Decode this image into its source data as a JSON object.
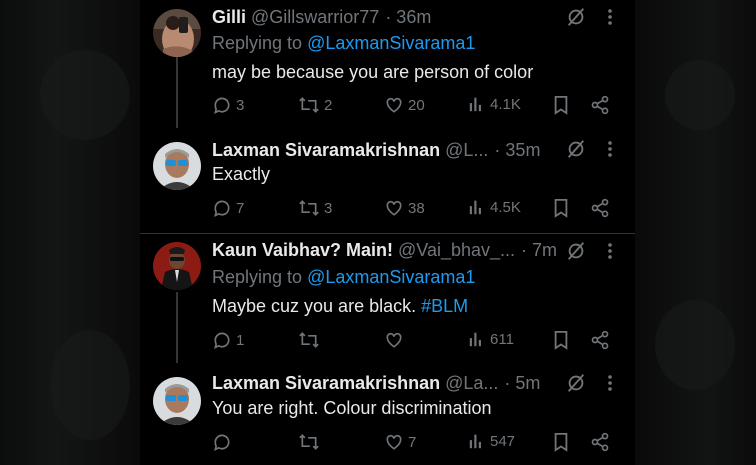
{
  "icons": {
    "grok": "grok-icon",
    "more": "more-icon",
    "reply": "reply-icon",
    "repost": "repost-icon",
    "like": "like-icon",
    "views": "views-icon",
    "bookmark": "bookmark-icon",
    "share": "share-icon"
  },
  "colors": {
    "background": "#000000",
    "text": "#e7e9ea",
    "muted": "#71767b",
    "accent": "#1d9bf0",
    "divider": "#2f3336"
  },
  "tweets": [
    {
      "name": "Gilli",
      "handle": "@Gillswarrior77",
      "time": "· 36m",
      "replying_label": "Replying to",
      "replying_to": "@LaxmanSivarama1",
      "text": "may be because you are person of color",
      "replies": "3",
      "reposts": "2",
      "likes": "20",
      "views": "4.1K"
    },
    {
      "name": "Laxman Sivaramakrishnan",
      "handle": "@L...",
      "time": "· 35m",
      "text": "Exactly",
      "replies": "7",
      "reposts": "3",
      "likes": "38",
      "views": "4.5K"
    },
    {
      "name": "Kaun Vaibhav? Main!",
      "handle": "@Vai_bhav_...",
      "time": "· 7m",
      "replying_label": "Replying to",
      "replying_to": "@LaxmanSivarama1",
      "text": "Maybe cuz you are black.",
      "hashtag": "#BLM",
      "replies": "1",
      "reposts": "",
      "likes": "",
      "views": "611"
    },
    {
      "name": "Laxman Sivaramakrishnan",
      "handle": "@La...",
      "time": "· 5m",
      "text": "You are right. Colour discrimination",
      "replies": "",
      "reposts": "",
      "likes": "7",
      "views": "547"
    }
  ]
}
